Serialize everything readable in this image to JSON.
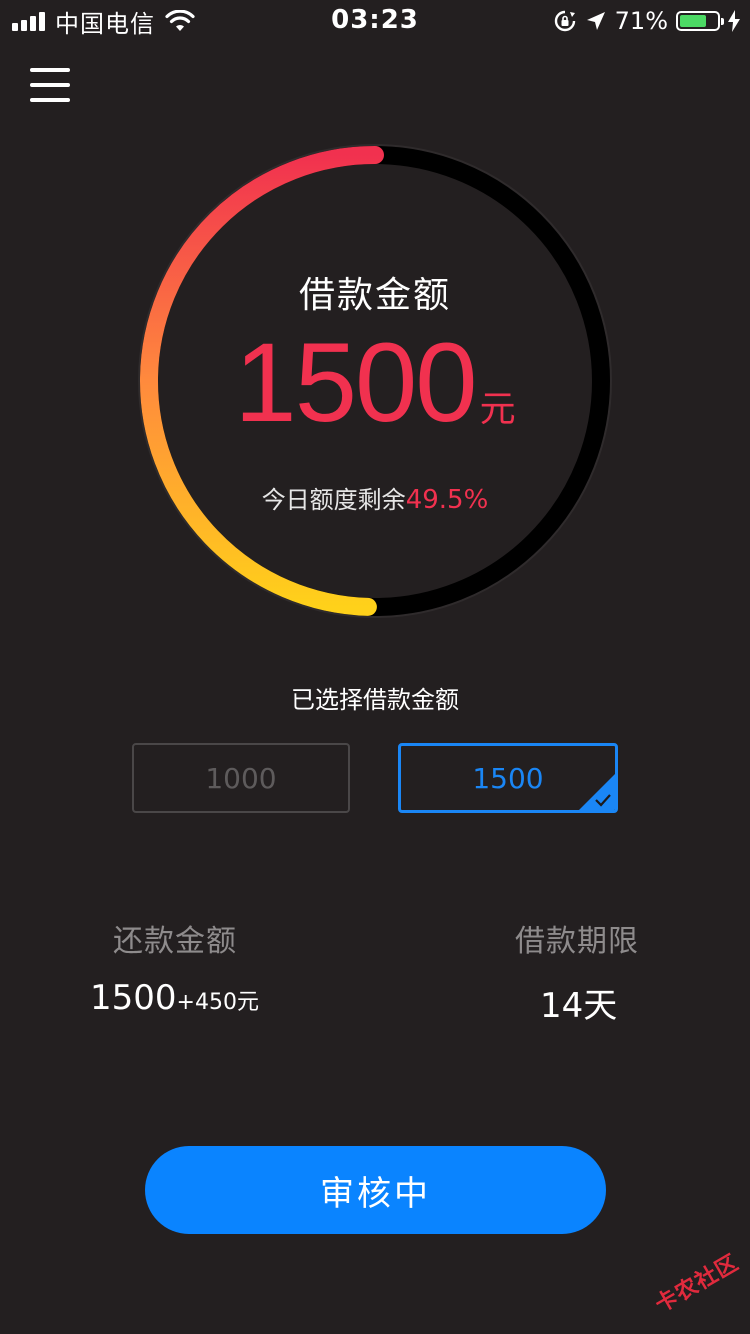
{
  "status_bar": {
    "carrier": "中国电信",
    "time": "03:23",
    "battery_percent": "71%",
    "battery_level": 0.71,
    "battery_color": "#4cd964"
  },
  "menu": {
    "icon": "hamburger-menu-icon"
  },
  "gauge": {
    "title": "借款金额",
    "amount": "1500",
    "unit": "元",
    "remaining_label": "今日额度剩余",
    "remaining_percent": "49.5%",
    "remaining_fraction": 0.495,
    "gradient_colors": [
      "#f1314f",
      "#ff8a3d",
      "#ffd11a"
    ],
    "track_color": "#000000"
  },
  "selection": {
    "label": "已选择借款金额",
    "options": [
      {
        "value": "1000",
        "selected": false
      },
      {
        "value": "1500",
        "selected": true
      }
    ]
  },
  "repayment": {
    "label": "还款金额",
    "principal": "1500",
    "extra": "+450元"
  },
  "term": {
    "label": "借款期限",
    "value": "14天"
  },
  "action_button": {
    "label": "审核中",
    "color": "#0a84ff"
  },
  "watermark": {
    "text": "卡农社区"
  },
  "colors": {
    "accent": "#f1314f",
    "primary": "#0a84ff",
    "background": "#231f20"
  }
}
